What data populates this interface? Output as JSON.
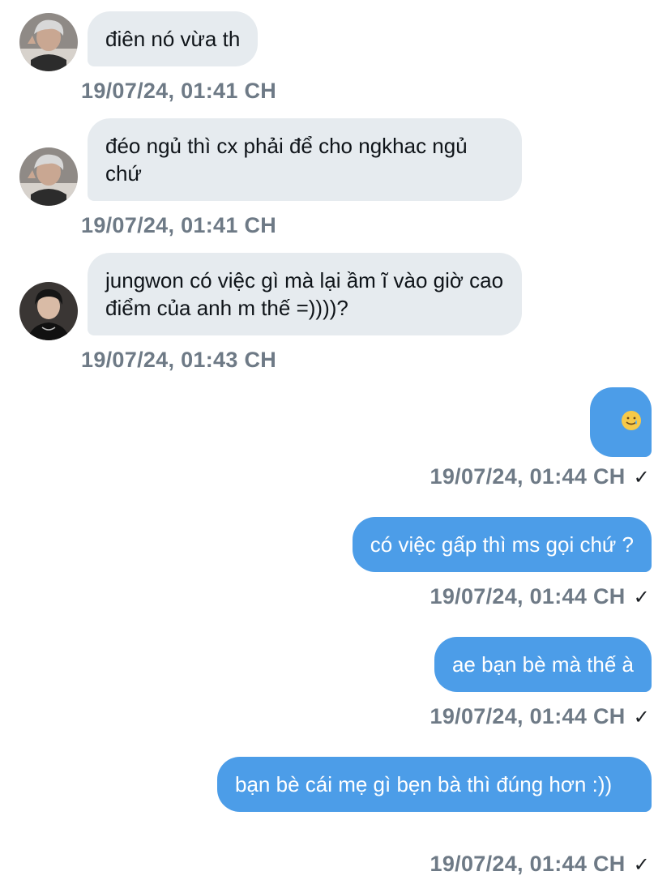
{
  "messages": [
    {
      "direction": "incoming",
      "avatar": "avatar-user-a",
      "text": "điên nó vừa th",
      "timestamp": "19/07/24, 01:41 CH"
    },
    {
      "direction": "incoming",
      "avatar": "avatar-user-a",
      "text": "đéo ngủ thì cx phải để cho ngkhac ngủ chứ",
      "timestamp": "19/07/24, 01:41 CH"
    },
    {
      "direction": "incoming",
      "avatar": "avatar-user-b",
      "text": "jungwon có việc gì mà lại ầm ĩ vào giờ cao điểm của anh m thế =))))?",
      "timestamp": "19/07/24, 01:43 CH"
    },
    {
      "direction": "outgoing",
      "text": "🥲",
      "emoji_name": "smiling-face-with-tear",
      "timestamp": "19/07/24, 01:44 CH",
      "status": "✓"
    },
    {
      "direction": "outgoing",
      "text": "có việc gấp thì ms gọi chứ ?",
      "timestamp": "19/07/24, 01:44 CH",
      "status": "✓"
    },
    {
      "direction": "outgoing",
      "text": "ae bạn bè mà thế à",
      "timestamp": "19/07/24, 01:44 CH",
      "status": "✓"
    },
    {
      "direction": "outgoing",
      "text": "bạn bè cái mẹ gì bẹn bà thì đúng hơn :))",
      "timestamp": "19/07/24, 01:44 CH",
      "status": "✓"
    }
  ],
  "colors": {
    "incoming_bubble": "#e6ebef",
    "outgoing_bubble": "#4c9de8",
    "timestamp": "#6e7a86",
    "text_dark": "#0f1419",
    "text_light": "#ffffff"
  }
}
